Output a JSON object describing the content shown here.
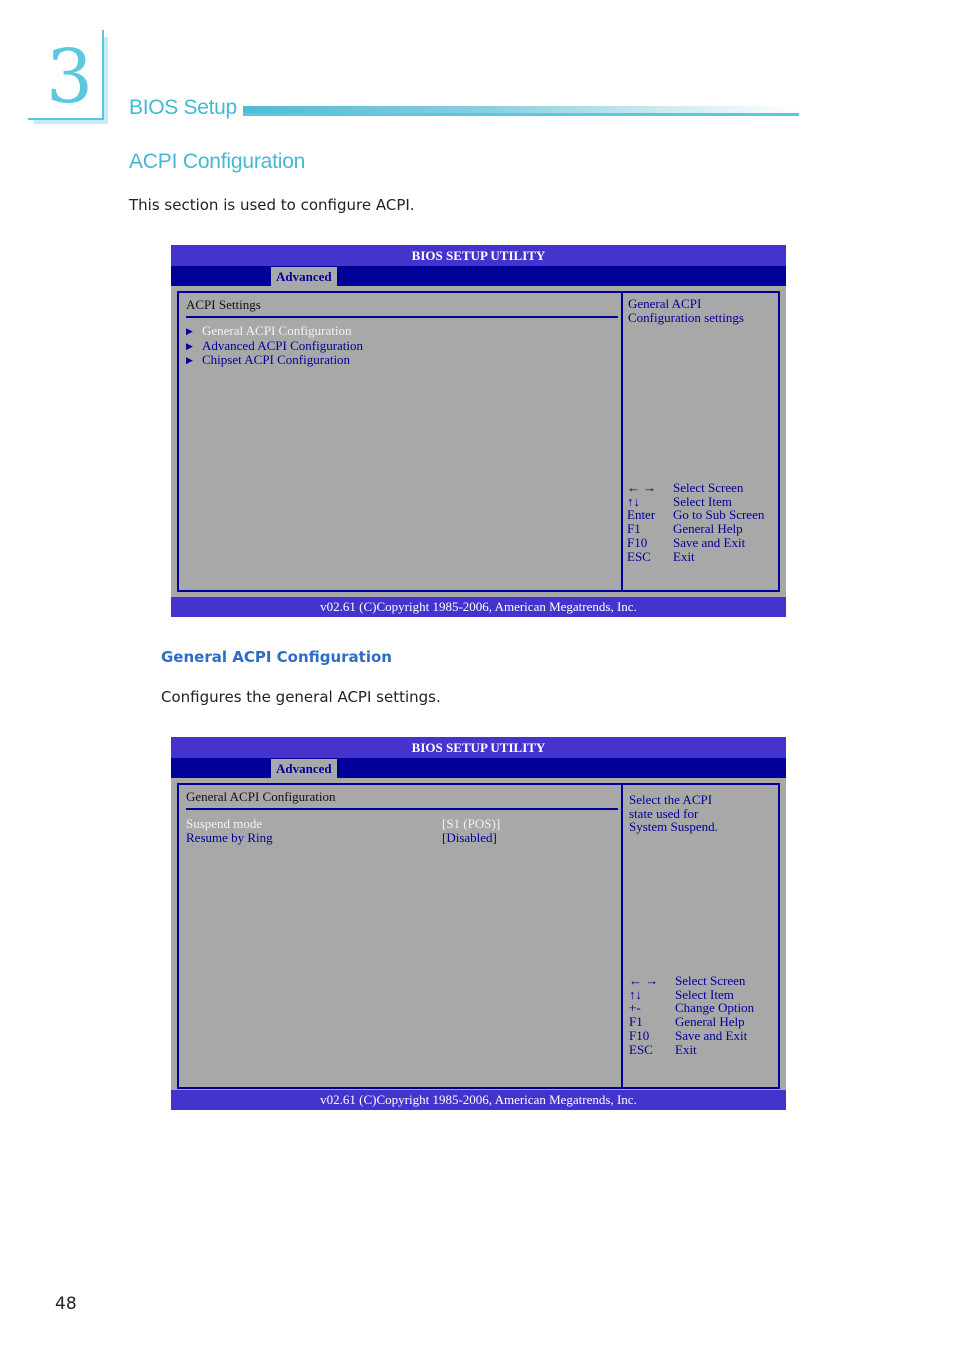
{
  "chapter": {
    "number": "3",
    "title": "BIOS Setup"
  },
  "section": {
    "title": "ACPI Configuration",
    "intro": "This section is used to configure ACPI."
  },
  "subsection": {
    "title": "General ACPI Configuration",
    "intro": "Configures the general ACPI settings."
  },
  "bios1": {
    "title": "BIOS SETUP UTILITY",
    "tab": "Advanced",
    "heading": "ACPI Settings",
    "menu": [
      {
        "label": "General ACPI Configuration",
        "selected": true
      },
      {
        "label": "Advanced ACPI Configuration",
        "selected": false
      },
      {
        "label": "Chipset ACPI Configuration",
        "selected": false
      }
    ],
    "help_line1": "General ACPI",
    "help_line2": "Configuration settings",
    "keys": [
      {
        "key": "← →",
        "action": "Select Screen"
      },
      {
        "key": "↑↓",
        "action": "Select Item"
      },
      {
        "key": "Enter",
        "action": "Go to Sub Screen"
      },
      {
        "key": "F1",
        "action": "General Help"
      },
      {
        "key": "F10",
        "action": "Save and Exit"
      },
      {
        "key": "ESC",
        "action": "Exit"
      }
    ],
    "footer": "v02.61 (C)Copyright 1985-2006, American Megatrends, Inc."
  },
  "bios2": {
    "title": "BIOS SETUP UTILITY",
    "tab": "Advanced",
    "heading": "General ACPI Configuration",
    "settings": [
      {
        "name": "Suspend mode",
        "value": "[S1 (POS)]",
        "selected": true
      },
      {
        "name": "Resume by Ring",
        "value": "[Disabled]",
        "selected": false
      }
    ],
    "help_line1": "Select the ACPI",
    "help_line2": "state used for",
    "help_line3": "System Suspend.",
    "keys": [
      {
        "key": "← →",
        "action": "Select Screen"
      },
      {
        "key": "↑↓",
        "action": "Select Item"
      },
      {
        "key": "+-",
        "action": "Change Option"
      },
      {
        "key": "F1",
        "action": "General Help"
      },
      {
        "key": "F10",
        "action": "Save and Exit"
      },
      {
        "key": "ESC",
        "action": "Exit"
      }
    ],
    "footer": "v02.61 (C)Copyright 1985-2006, American Megatrends, Inc."
  },
  "page": {
    "number": "48"
  },
  "colors": {
    "accent_cyan": "#5bc8df",
    "bios_title_blue": "#4433cc",
    "bios_dark_blue": "#000099",
    "bios_gray": "#a8a8a8",
    "subsection_blue": "#2f6cc4"
  }
}
